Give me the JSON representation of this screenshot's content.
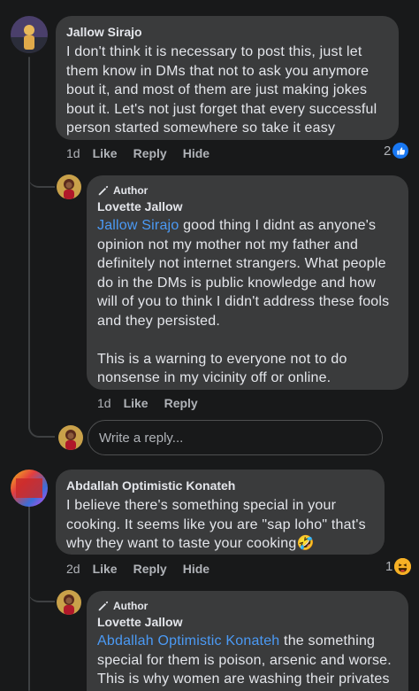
{
  "comments": {
    "c1": {
      "name": "Jallow Sirajo",
      "text": "I don't think it is necessary to post this, just let them know in DMs that not to ask you anymore bout it, and most of them are just making jokes bout it. Let's not just forget that every successful person started somewhere so take it easy",
      "age": "1d",
      "like": "Like",
      "reply": "Reply",
      "hide": "Hide",
      "reaction_count": "2",
      "reaction_icon": "like-icon",
      "colors": {
        "like": "#1877f2"
      }
    },
    "r1": {
      "author_badge": "Author",
      "name": "Lovette Jallow",
      "tag": "Jallow Sirajo",
      "text": " good thing I didnt as anyone's opinion not my mother not my father and definitely not internet strangers. What people do in the DMs is public knowledge and how will of you to think I didn't address these fools and they persisted.\n\nThis is a warning to everyone not to do nonsense in my vicinity off or online.",
      "age": "1d",
      "like": "Like",
      "reply": "Reply"
    },
    "reply_box": {
      "placeholder": "Write a reply..."
    },
    "c2": {
      "name": "Abdallah Optimistic Konateh",
      "text": "I believe there's something special in your cooking. It seems like you are \"sap loho\" that's why they want to taste your cooking",
      "emoji": "🤣",
      "age": "2d",
      "like": "Like",
      "reply": "Reply",
      "hide": "Hide",
      "reaction_count": "1",
      "reaction_icon": "haha-icon",
      "colors": {
        "haha": "#f7b125"
      }
    },
    "r2": {
      "author_badge": "Author",
      "name": "Lovette Jallow",
      "tag": "Abdallah Optimistic Konateh",
      "text": " the something special for them is poison, arsenic and worse. This is why women are washing their privates"
    }
  },
  "colors": {
    "background": "#18191a",
    "bubble": "#3a3b3c",
    "link": "#4b9af5",
    "muted": "#b0b3b8"
  }
}
